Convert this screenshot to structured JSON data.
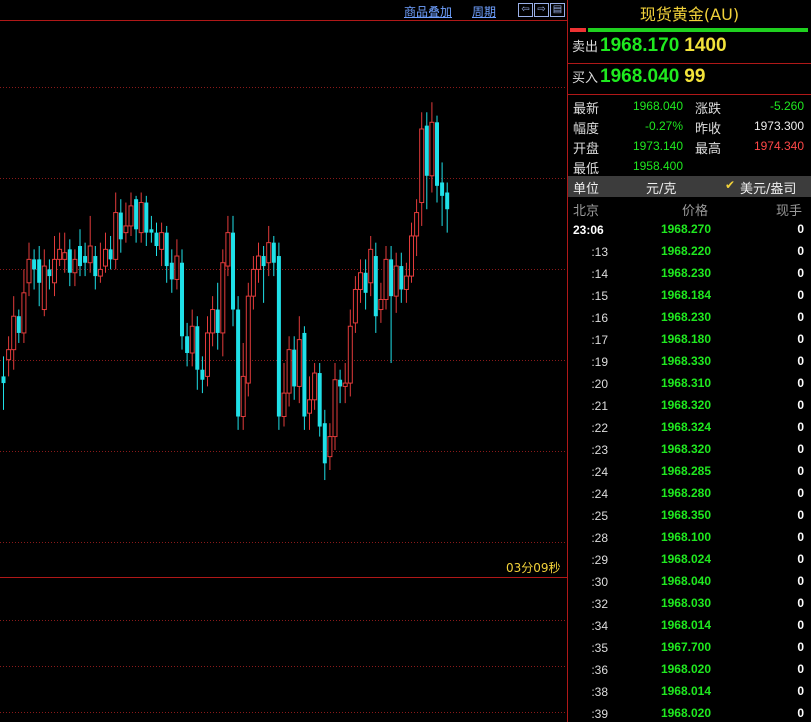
{
  "toolbar": {
    "overlay_label": "商品叠加",
    "period_label": "周期",
    "prev_icon": "arrow-left-icon",
    "next_icon": "arrow-right-icon",
    "panel_icon": "panel-toggle-icon"
  },
  "chart": {
    "timer": "03分09秒",
    "grid_color": "#8a1a1a",
    "up_color": "#e23b3b",
    "down_color": "#1fe0e8"
  },
  "chart_data": {
    "type": "candlestick",
    "candles": [
      {
        "o": 1963.0,
        "c": 1962.8,
        "h": 1963.6,
        "l": 1962.0
      },
      {
        "o": 1963.5,
        "c": 1963.8,
        "h": 1964.2,
        "l": 1963.0
      },
      {
        "o": 1963.8,
        "c": 1964.8,
        "h": 1965.4,
        "l": 1963.2
      },
      {
        "o": 1964.8,
        "c": 1964.3,
        "h": 1965.0,
        "l": 1964.0
      },
      {
        "o": 1964.3,
        "c": 1965.5,
        "h": 1966.2,
        "l": 1964.0
      },
      {
        "o": 1965.8,
        "c": 1966.5,
        "h": 1967.0,
        "l": 1965.4
      },
      {
        "o": 1966.5,
        "c": 1966.2,
        "h": 1966.8,
        "l": 1965.6
      },
      {
        "o": 1966.5,
        "c": 1965.8,
        "h": 1966.9,
        "l": 1965.1
      },
      {
        "o": 1965.0,
        "c": 1966.3,
        "h": 1966.8,
        "l": 1964.8
      },
      {
        "o": 1966.2,
        "c": 1966.0,
        "h": 1966.5,
        "l": 1965.6
      },
      {
        "o": 1965.8,
        "c": 1966.5,
        "h": 1967.2,
        "l": 1965.4
      },
      {
        "o": 1966.5,
        "c": 1966.8,
        "h": 1967.3,
        "l": 1966.3
      },
      {
        "o": 1966.5,
        "c": 1966.7,
        "h": 1967.3,
        "l": 1966.1
      },
      {
        "o": 1966.8,
        "c": 1966.1,
        "h": 1967.1,
        "l": 1965.7
      },
      {
        "o": 1966.1,
        "c": 1966.5,
        "h": 1966.8,
        "l": 1965.7
      },
      {
        "o": 1966.9,
        "c": 1966.3,
        "h": 1967.4,
        "l": 1966.0
      },
      {
        "o": 1966.6,
        "c": 1966.4,
        "h": 1967.0,
        "l": 1966.0
      },
      {
        "o": 1966.4,
        "c": 1966.9,
        "h": 1967.8,
        "l": 1966.1
      },
      {
        "o": 1966.6,
        "c": 1966.0,
        "h": 1966.9,
        "l": 1965.6
      },
      {
        "o": 1966.0,
        "c": 1966.2,
        "h": 1967.0,
        "l": 1965.8
      },
      {
        "o": 1966.3,
        "c": 1966.8,
        "h": 1967.3,
        "l": 1966.1
      },
      {
        "o": 1966.8,
        "c": 1966.5,
        "h": 1967.2,
        "l": 1966.2
      },
      {
        "o": 1966.5,
        "c": 1967.9,
        "h": 1968.5,
        "l": 1966.2
      },
      {
        "o": 1967.9,
        "c": 1967.1,
        "h": 1968.3,
        "l": 1966.7
      },
      {
        "o": 1967.3,
        "c": 1967.5,
        "h": 1968.2,
        "l": 1967.0
      },
      {
        "o": 1967.5,
        "c": 1968.1,
        "h": 1968.5,
        "l": 1967.2
      },
      {
        "o": 1968.3,
        "c": 1967.4,
        "h": 1968.4,
        "l": 1967.0
      },
      {
        "o": 1967.3,
        "c": 1968.2,
        "h": 1968.5,
        "l": 1967.0
      },
      {
        "o": 1968.2,
        "c": 1967.3,
        "h": 1968.4,
        "l": 1966.9
      },
      {
        "o": 1967.4,
        "c": 1967.3,
        "h": 1967.8,
        "l": 1967.0
      },
      {
        "o": 1967.3,
        "c": 1966.9,
        "h": 1967.6,
        "l": 1966.6
      },
      {
        "o": 1966.8,
        "c": 1967.3,
        "h": 1967.6,
        "l": 1966.3
      },
      {
        "o": 1967.3,
        "c": 1966.3,
        "h": 1967.5,
        "l": 1965.8
      },
      {
        "o": 1966.4,
        "c": 1965.9,
        "h": 1966.8,
        "l": 1965.5
      },
      {
        "o": 1965.9,
        "c": 1966.6,
        "h": 1967.1,
        "l": 1965.6
      },
      {
        "o": 1966.4,
        "c": 1964.2,
        "h": 1966.8,
        "l": 1963.8
      },
      {
        "o": 1964.2,
        "c": 1963.7,
        "h": 1964.6,
        "l": 1963.3
      },
      {
        "o": 1963.7,
        "c": 1964.5,
        "h": 1965.0,
        "l": 1963.3
      },
      {
        "o": 1964.5,
        "c": 1963.2,
        "h": 1964.8,
        "l": 1962.6
      },
      {
        "o": 1963.2,
        "c": 1962.9,
        "h": 1963.6,
        "l": 1962.5
      },
      {
        "o": 1963.0,
        "c": 1964.3,
        "h": 1964.8,
        "l": 1962.7
      },
      {
        "o": 1964.3,
        "c": 1965.0,
        "h": 1965.4,
        "l": 1963.9
      },
      {
        "o": 1965.0,
        "c": 1964.3,
        "h": 1965.8,
        "l": 1963.8
      },
      {
        "o": 1964.3,
        "c": 1966.4,
        "h": 1966.8,
        "l": 1963.6
      },
      {
        "o": 1966.3,
        "c": 1967.3,
        "h": 1967.8,
        "l": 1966.0
      },
      {
        "o": 1967.3,
        "c": 1965.0,
        "h": 1967.8,
        "l": 1964.5
      },
      {
        "o": 1965.0,
        "c": 1961.8,
        "h": 1965.4,
        "l": 1961.4
      },
      {
        "o": 1961.8,
        "c": 1963.0,
        "h": 1964.0,
        "l": 1961.4
      },
      {
        "o": 1962.8,
        "c": 1965.4,
        "h": 1965.8,
        "l": 1962.4
      },
      {
        "o": 1965.4,
        "c": 1966.2,
        "h": 1966.6,
        "l": 1965.0
      },
      {
        "o": 1966.2,
        "c": 1966.6,
        "h": 1967.0,
        "l": 1965.8
      },
      {
        "o": 1966.6,
        "c": 1966.3,
        "h": 1966.9,
        "l": 1965.2
      },
      {
        "o": 1966.4,
        "c": 1967.0,
        "h": 1967.5,
        "l": 1966.0
      },
      {
        "o": 1967.0,
        "c": 1966.4,
        "h": 1967.2,
        "l": 1966.0
      },
      {
        "o": 1966.6,
        "c": 1961.8,
        "h": 1967.0,
        "l": 1961.4
      },
      {
        "o": 1961.8,
        "c": 1962.5,
        "h": 1963.4,
        "l": 1961.5
      },
      {
        "o": 1962.5,
        "c": 1963.8,
        "h": 1964.2,
        "l": 1962.1
      },
      {
        "o": 1963.8,
        "c": 1962.7,
        "h": 1964.2,
        "l": 1962.3
      },
      {
        "o": 1962.7,
        "c": 1964.1,
        "h": 1964.8,
        "l": 1962.2
      },
      {
        "o": 1964.3,
        "c": 1961.8,
        "h": 1964.5,
        "l": 1961.4
      },
      {
        "o": 1961.9,
        "c": 1962.3,
        "h": 1963.0,
        "l": 1961.4
      },
      {
        "o": 1962.3,
        "c": 1963.1,
        "h": 1963.4,
        "l": 1962.0
      },
      {
        "o": 1963.1,
        "c": 1961.5,
        "h": 1963.4,
        "l": 1961.2
      },
      {
        "o": 1961.6,
        "c": 1960.4,
        "h": 1962.0,
        "l": 1959.9
      },
      {
        "o": 1960.6,
        "c": 1961.2,
        "h": 1961.6,
        "l": 1960.2
      },
      {
        "o": 1961.2,
        "c": 1962.9,
        "h": 1963.4,
        "l": 1960.8
      },
      {
        "o": 1962.9,
        "c": 1962.7,
        "h": 1963.2,
        "l": 1962.2
      },
      {
        "o": 1962.7,
        "c": 1962.8,
        "h": 1963.4,
        "l": 1962.2
      },
      {
        "o": 1962.8,
        "c": 1964.5,
        "h": 1965.0,
        "l": 1962.4
      },
      {
        "o": 1964.6,
        "c": 1965.6,
        "h": 1966.0,
        "l": 1964.3
      },
      {
        "o": 1965.6,
        "c": 1966.1,
        "h": 1966.5,
        "l": 1965.2
      },
      {
        "o": 1966.1,
        "c": 1965.5,
        "h": 1966.5,
        "l": 1965.0
      },
      {
        "o": 1965.8,
        "c": 1966.8,
        "h": 1967.2,
        "l": 1965.4
      },
      {
        "o": 1966.6,
        "c": 1964.8,
        "h": 1967.0,
        "l": 1964.3
      },
      {
        "o": 1965.0,
        "c": 1965.3,
        "h": 1965.8,
        "l": 1964.6
      },
      {
        "o": 1965.3,
        "c": 1966.5,
        "h": 1966.9,
        "l": 1965.0
      },
      {
        "o": 1966.5,
        "c": 1965.4,
        "h": 1966.9,
        "l": 1963.4
      },
      {
        "o": 1965.4,
        "c": 1966.3,
        "h": 1966.7,
        "l": 1964.9
      },
      {
        "o": 1966.3,
        "c": 1965.6,
        "h": 1966.7,
        "l": 1965.2
      },
      {
        "o": 1965.6,
        "c": 1966.0,
        "h": 1966.4,
        "l": 1965.2
      },
      {
        "o": 1966.0,
        "c": 1967.2,
        "h": 1967.6,
        "l": 1965.8
      },
      {
        "o": 1967.2,
        "c": 1967.9,
        "h": 1968.3,
        "l": 1966.6
      },
      {
        "o": 1968.2,
        "c": 1970.4,
        "h": 1970.9,
        "l": 1967.5
      },
      {
        "o": 1970.5,
        "c": 1969.0,
        "h": 1970.9,
        "l": 1968.0
      },
      {
        "o": 1969.0,
        "c": 1970.6,
        "h": 1971.2,
        "l": 1968.5
      },
      {
        "o": 1970.6,
        "c": 1968.7,
        "h": 1970.8,
        "l": 1968.2
      },
      {
        "o": 1968.8,
        "c": 1968.4,
        "h": 1969.4,
        "l": 1967.5
      },
      {
        "o": 1968.5,
        "c": 1968.0,
        "h": 1968.8,
        "l": 1967.3
      }
    ],
    "ylim": [
      1957.0,
      1973.6
    ],
    "xlabel": "",
    "ylabel": ""
  },
  "quote": {
    "title": "现货黄金(AU)",
    "sell_label": "卖出",
    "sell_price": "1968.170",
    "sell_volume": "1400",
    "buy_label": "买入",
    "buy_price": "1968.040",
    "buy_volume": "99",
    "stats": {
      "latest_label": "最新",
      "latest_value": "1968.040",
      "change_label": "涨跌",
      "change_value": "-5.260",
      "range_label": "幅度",
      "range_value": "-0.27%",
      "prev_close_label": "昨收",
      "prev_close_value": "1973.300",
      "open_label": "开盘",
      "open_value": "1973.140",
      "high_label": "最高",
      "high_value": "1974.340",
      "low_label": "最低",
      "low_value": "1958.400"
    },
    "unit": {
      "label": "单位",
      "value": "元/克",
      "check_icon": "check-icon",
      "option": "美元/盎司"
    },
    "tick_header": {
      "time": "北京",
      "price": "价格",
      "volume": "现手"
    },
    "ticks": [
      {
        "time": "23:06",
        "price": "1968.270",
        "volume": "0"
      },
      {
        "time": ":13",
        "price": "1968.220",
        "volume": "0"
      },
      {
        "time": ":14",
        "price": "1968.230",
        "volume": "0"
      },
      {
        "time": ":15",
        "price": "1968.184",
        "volume": "0"
      },
      {
        "time": ":16",
        "price": "1968.230",
        "volume": "0"
      },
      {
        "time": ":17",
        "price": "1968.180",
        "volume": "0"
      },
      {
        "time": ":19",
        "price": "1968.330",
        "volume": "0"
      },
      {
        "time": ":20",
        "price": "1968.310",
        "volume": "0"
      },
      {
        "time": ":21",
        "price": "1968.320",
        "volume": "0"
      },
      {
        "time": ":22",
        "price": "1968.324",
        "volume": "0"
      },
      {
        "time": ":23",
        "price": "1968.320",
        "volume": "0"
      },
      {
        "time": ":24",
        "price": "1968.285",
        "volume": "0"
      },
      {
        "time": ":24",
        "price": "1968.280",
        "volume": "0"
      },
      {
        "time": ":25",
        "price": "1968.350",
        "volume": "0"
      },
      {
        "time": ":28",
        "price": "1968.100",
        "volume": "0"
      },
      {
        "time": ":29",
        "price": "1968.024",
        "volume": "0"
      },
      {
        "time": ":30",
        "price": "1968.040",
        "volume": "0"
      },
      {
        "time": ":32",
        "price": "1968.030",
        "volume": "0"
      },
      {
        "time": ":34",
        "price": "1968.014",
        "volume": "0"
      },
      {
        "time": ":35",
        "price": "1967.700",
        "volume": "0"
      },
      {
        "time": ":36",
        "price": "1968.020",
        "volume": "0"
      },
      {
        "time": ":38",
        "price": "1968.014",
        "volume": "0"
      },
      {
        "time": ":39",
        "price": "1968.020",
        "volume": "0"
      }
    ]
  }
}
